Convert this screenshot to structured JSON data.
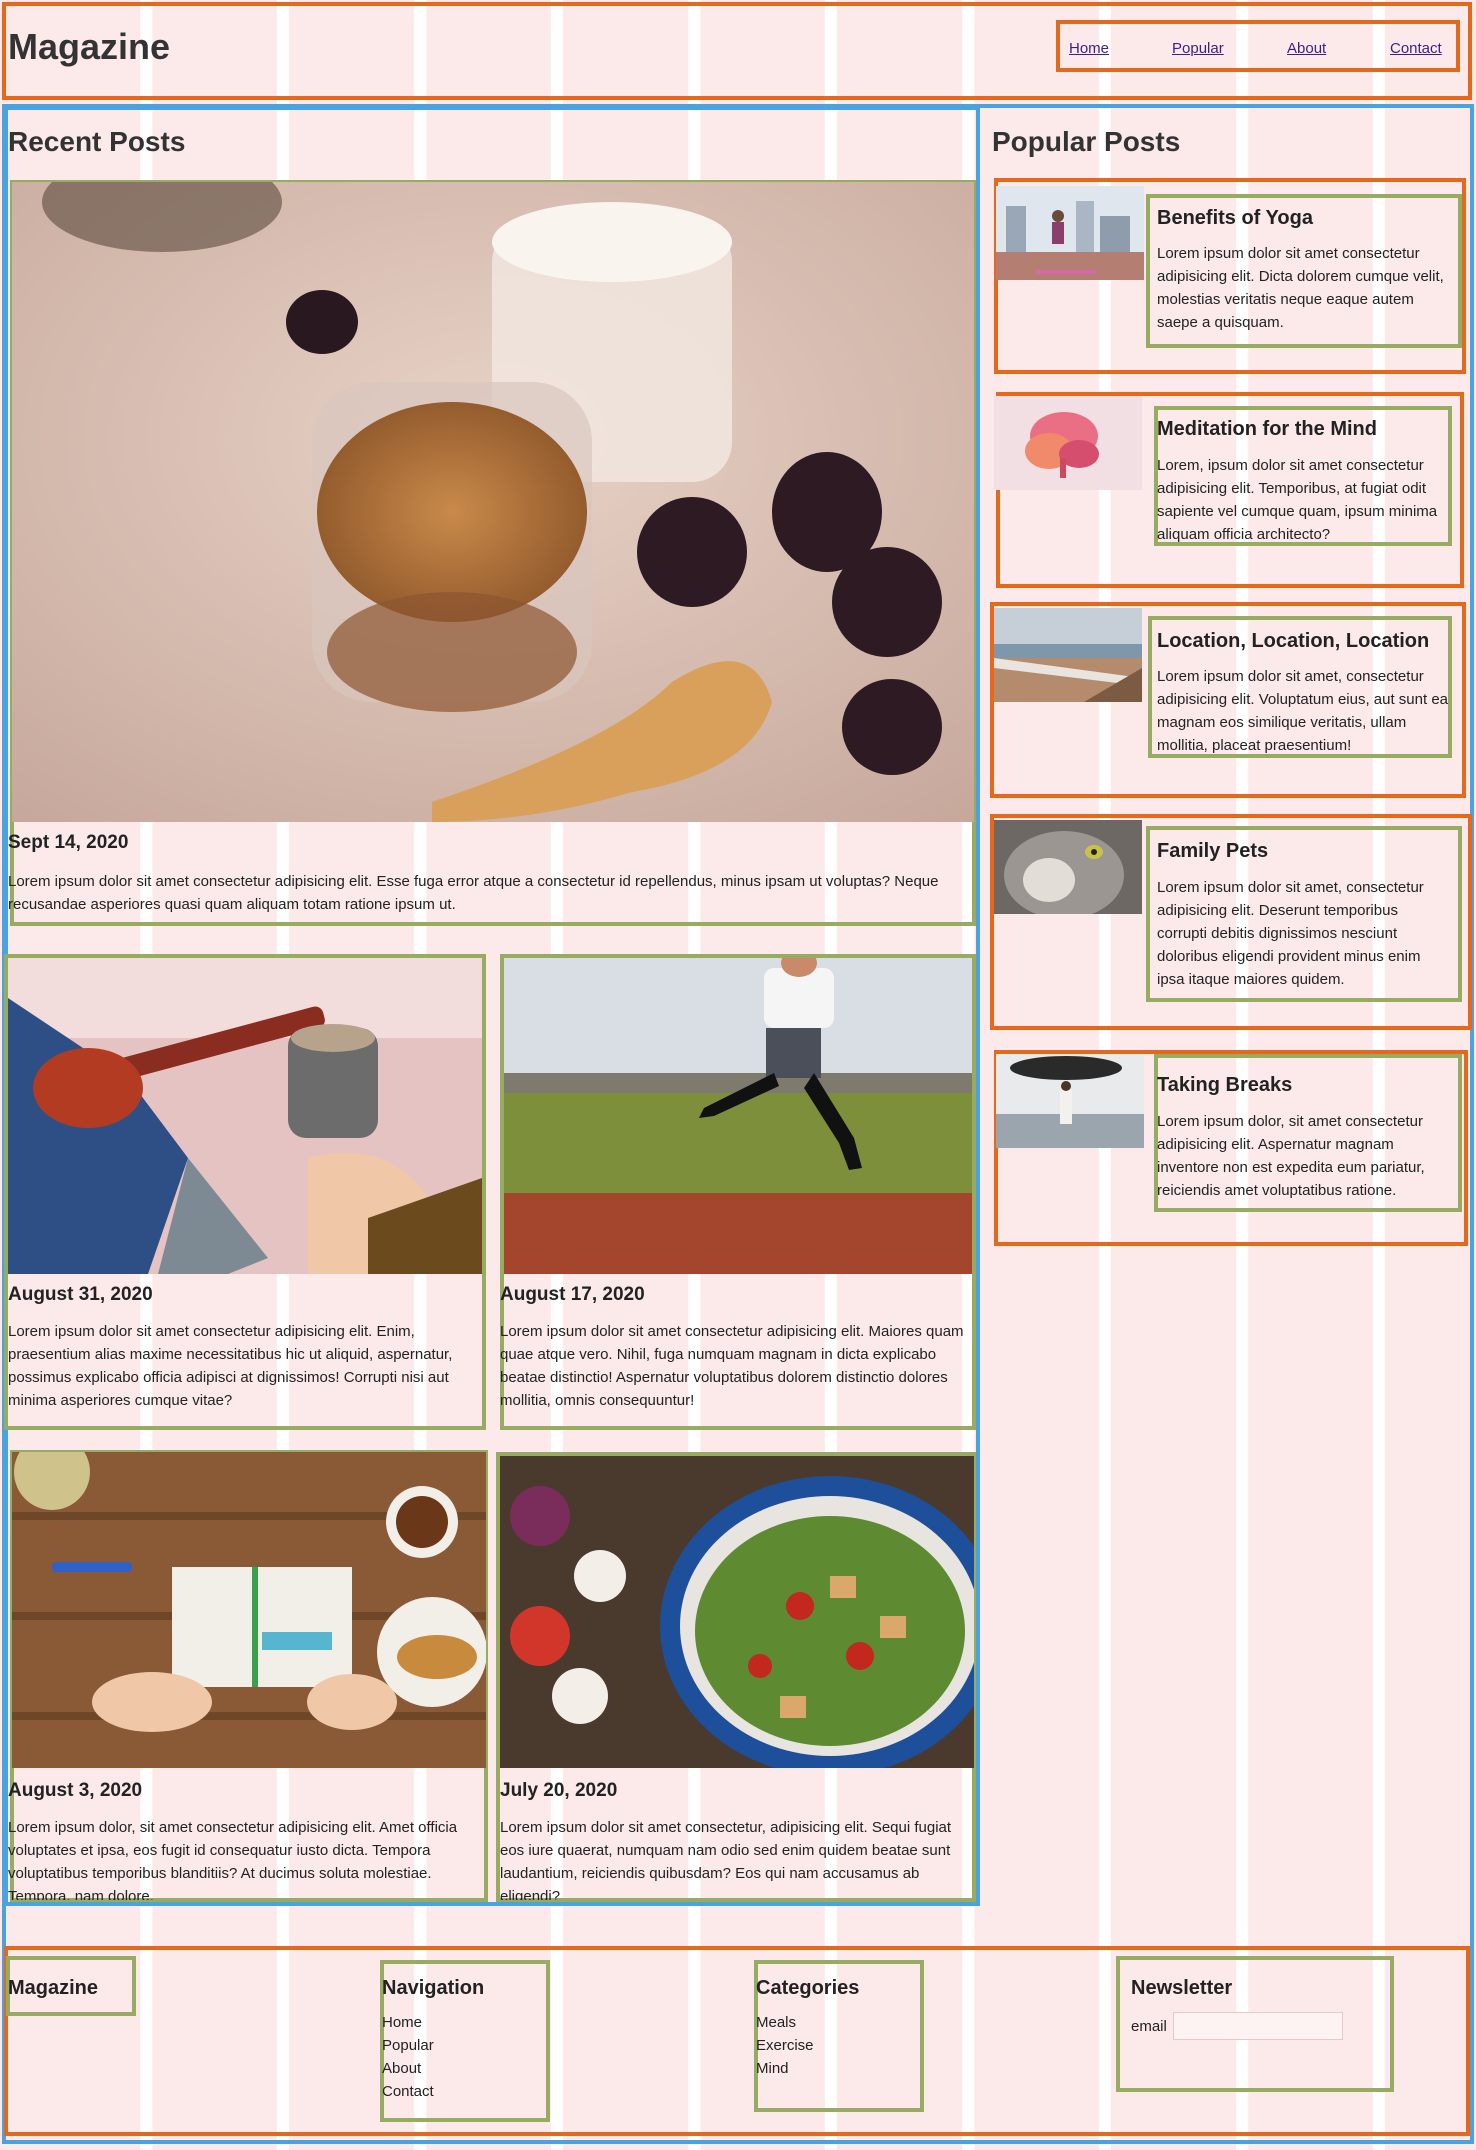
{
  "header": {
    "site_title": "Magazine",
    "nav": [
      "Home",
      "Popular",
      "About",
      "Contact"
    ]
  },
  "recent": {
    "heading": "Recent Posts",
    "featured": {
      "image": "granola-jar-with-blackberries",
      "date": "Sept 14, 2020",
      "excerpt": "Lorem ipsum dolor sit amet consectetur adipisicing elit. Esse fuga error atque a consectetur id repellendus, minus ipsam ut voluptas? Neque recusandae asperiores quasi quam aliquam totam ratione ipsum ut."
    },
    "posts": [
      {
        "image": "coffee-and-ukulele",
        "date": "August 31, 2020",
        "excerpt": "Lorem ipsum dolor sit amet consectetur adipisicing elit. Enim, praesentium alias maxime necessitatibus hic ut aliquid, aspernatur, possimus explicabo officia adipisci at dignissimos! Corrupti nisi aut minima asperiores cumque vitae?"
      },
      {
        "image": "runner-on-track",
        "date": "August 17, 2020",
        "excerpt": "Lorem ipsum dolor sit amet consectetur adipisicing elit. Maiores quam quae atque vero. Nihil, fuga numquam magnam in dicta explicabo beatae distinctio! Aspernatur voluptatibus dolorem distinctio dolores mollitia, omnis consequuntur!"
      },
      {
        "image": "planner-and-croissant",
        "date": "August 3, 2020",
        "excerpt": "Lorem ipsum dolor, sit amet consectetur adipisicing elit. Amet officia voluptates et ipsa, eos fugit id consequatur iusto dicta. Tempora voluptatibus temporibus blanditiis? At ducimus soluta molestiae. Tempora, nam dolore."
      },
      {
        "image": "salad-bowl",
        "date": "July 20, 2020",
        "excerpt": "Lorem ipsum dolor sit amet consectetur, adipisicing elit. Sequi fugiat eos iure quaerat, numquam nam odio sed enim quidem beatae sunt laudantium, reiciendis quibusdam? Eos qui nam accusamus ab eligendi?"
      }
    ]
  },
  "popular": {
    "heading": "Popular Posts",
    "items": [
      {
        "image": "yoga-city-rooftop",
        "title": "Benefits of Yoga",
        "text": "Lorem ipsum dolor sit amet consectetur adipisicing elit. Dicta dolorem cumque velit, molestias veritatis neque eaque autem saepe a quisquam."
      },
      {
        "image": "pink-ink-cloud",
        "title": "Meditation for the Mind",
        "text": "Lorem, ipsum dolor sit amet consectetur adipisicing elit. Temporibus, at fugiat odit sapiente vel cumque quam, ipsum minima aliquam officia architecto?"
      },
      {
        "image": "beach-stairs",
        "title": "Location, Location, Location",
        "text": "Lorem ipsum dolor sit amet, consectetur adipisicing elit. Voluptatum eius, aut sunt ea magnam eos similique veritatis, ullam mollitia, placeat praesentium!"
      },
      {
        "image": "grey-cat",
        "title": "Family Pets",
        "text": "Lorem ipsum dolor sit amet, consectetur adipisicing elit. Deserunt temporibus corrupti debitis dignissimos nesciunt doloribus eligendi provident minus enim ipsa itaque maiores quidem."
      },
      {
        "image": "woman-with-umbrella-by-sea",
        "title": "Taking Breaks",
        "text": "Lorem ipsum dolor, sit amet consectetur adipisicing elit. Aspernatur magnam inventore non est expedita eum pariatur, reiciendis amet voluptatibus ratione."
      }
    ]
  },
  "footer": {
    "brand": "Magazine",
    "navigation": {
      "title": "Navigation",
      "links": [
        "Home",
        "Popular",
        "About",
        "Contact"
      ]
    },
    "categories": {
      "title": "Categories",
      "links": [
        "Meals",
        "Exercise",
        "Mind"
      ]
    },
    "newsletter": {
      "title": "Newsletter",
      "email_label": "email",
      "email_value": ""
    }
  },
  "colors": {
    "background": "#fce9ea",
    "outline_orange": "#e4691d",
    "outline_blue": "#4aa3e0",
    "outline_green": "#98ab62",
    "link": "#3a1f8a"
  }
}
